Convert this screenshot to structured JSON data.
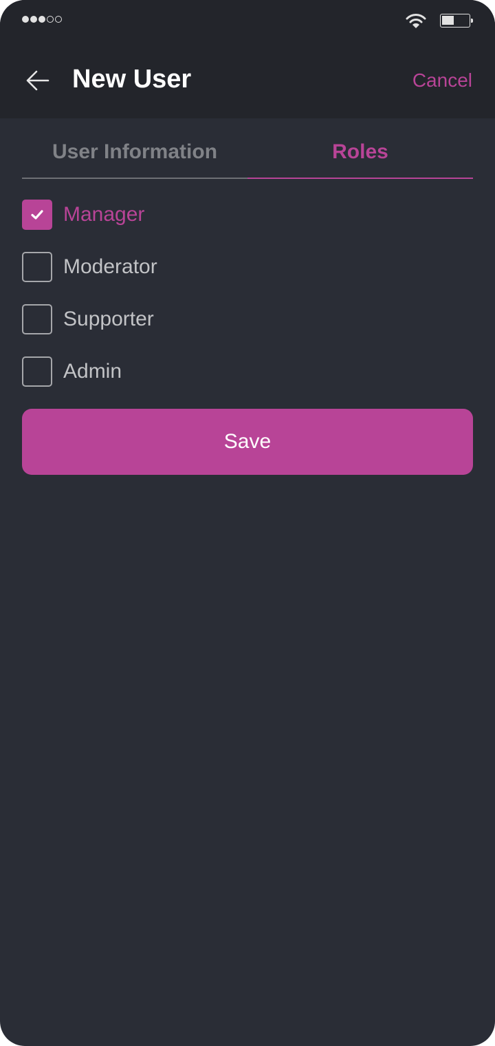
{
  "status_bar": {
    "signal_bars_filled": 3,
    "signal_bars_total": 5,
    "wifi_icon": "wifi-icon",
    "battery_level": 0.45
  },
  "header": {
    "back_icon": "arrow-left-icon",
    "title": "New User",
    "cancel_label": "Cancel"
  },
  "tabs": [
    {
      "label": "User Information",
      "active": false
    },
    {
      "label": "Roles",
      "active": true
    }
  ],
  "roles": [
    {
      "label": "Manager",
      "checked": true
    },
    {
      "label": "Moderator",
      "checked": false
    },
    {
      "label": "Supporter",
      "checked": false
    },
    {
      "label": "Admin",
      "checked": false
    }
  ],
  "save_label": "Save",
  "colors": {
    "accent": "#b84497",
    "header_bg": "#23252b",
    "page_bg": "#2a2d36",
    "text_muted": "#808287",
    "text_light": "#c2c3c6"
  }
}
